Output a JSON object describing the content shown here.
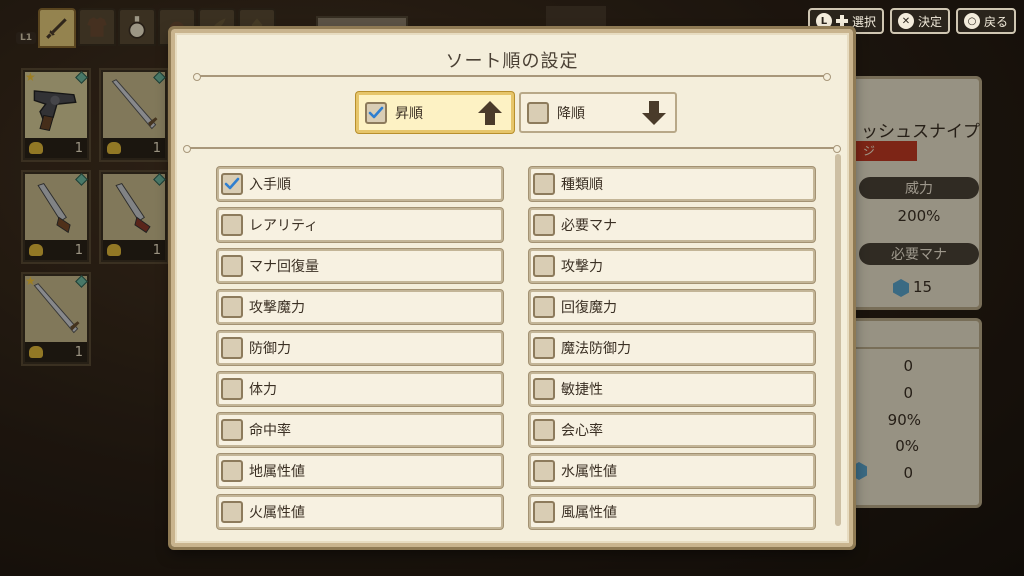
{
  "modal": {
    "title": "ソート順の設定",
    "ascending": {
      "label": "昇順",
      "checked": true,
      "icon": "arrow-up-icon"
    },
    "descending": {
      "label": "降順",
      "checked": false,
      "icon": "arrow-down-icon"
    },
    "options": [
      {
        "label": "入手順",
        "checked": true
      },
      {
        "label": "種類順",
        "checked": false
      },
      {
        "label": "レアリティ",
        "checked": false
      },
      {
        "label": "必要マナ",
        "checked": false
      },
      {
        "label": "マナ回復量",
        "checked": false
      },
      {
        "label": "攻撃力",
        "checked": false
      },
      {
        "label": "攻撃魔力",
        "checked": false
      },
      {
        "label": "回復魔力",
        "checked": false
      },
      {
        "label": "防御力",
        "checked": false
      },
      {
        "label": "魔法防御力",
        "checked": false
      },
      {
        "label": "体力",
        "checked": false
      },
      {
        "label": "敏捷性",
        "checked": false
      },
      {
        "label": "命中率",
        "checked": false
      },
      {
        "label": "会心率",
        "checked": false
      },
      {
        "label": "地属性値",
        "checked": false
      },
      {
        "label": "水属性値",
        "checked": false
      },
      {
        "label": "火属性値",
        "checked": false
      },
      {
        "label": "風属性値",
        "checked": false
      }
    ]
  },
  "button_hints": [
    {
      "key": "L",
      "label": "選択",
      "icon": "l-dpad-icon"
    },
    {
      "key": "✕",
      "label": "決定",
      "icon": "cross-button-icon"
    },
    {
      "key": "○",
      "label": "戻る",
      "icon": "circle-button-icon"
    }
  ],
  "controller_hint": "L1",
  "category_tabs": [
    "sword-icon",
    "armor-icon",
    "potion-icon",
    "bag-icon",
    "herb-icon",
    "chess-icon"
  ],
  "inventory": [
    {
      "icon": "revolver-icon",
      "count": "1",
      "selected": true
    },
    {
      "icon": "sword-icon",
      "count": "1",
      "selected": false
    },
    {
      "icon": "dagger-icon",
      "count": "1",
      "selected": false
    },
    {
      "icon": "dagger-icon",
      "count": "1",
      "selected": false
    },
    {
      "icon": "sword-icon",
      "count": "1",
      "selected": false
    }
  ],
  "detail": {
    "name": "ッシュスナイプ",
    "tag": "ジ",
    "power_label": "威力",
    "power_value": "200%",
    "mana_label": "必要マナ",
    "mana_value": "15",
    "rows": [
      "0",
      "0",
      "90%",
      "0%",
      "0"
    ]
  },
  "colors": {
    "modal_bg": "#f4eedb",
    "checkbox_check": "#2f7fd0",
    "arrow": "#4a3b2a",
    "highlight_border": "#e6c56a"
  }
}
